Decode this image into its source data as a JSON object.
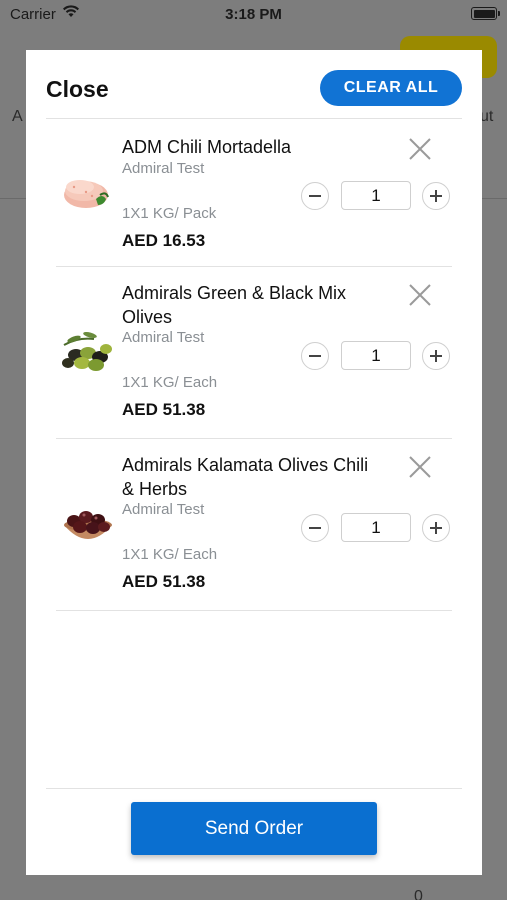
{
  "status_bar": {
    "carrier": "Carrier",
    "time": "3:18 PM"
  },
  "background": {
    "left_fragment": "A",
    "right_fragment": "ut",
    "bottom_qty": "0"
  },
  "modal": {
    "close_label": "Close",
    "clear_all_label": "CLEAR ALL",
    "send_order_label": "Send Order",
    "items": [
      {
        "name": "ADM Chili Mortadella",
        "brand": "Admiral Test",
        "pack": "1X1 KG/ Pack",
        "price": "AED 16.53",
        "qty": "1",
        "image_icon": "mortadella-image"
      },
      {
        "name": "Admirals Green & Black Mix Olives",
        "brand": "Admiral Test",
        "pack": "1X1 KG/ Each",
        "price": "AED 51.38",
        "qty": "1",
        "image_icon": "olives-image"
      },
      {
        "name": "Admirals Kalamata Olives Chili & Herbs",
        "brand": "Admiral Test",
        "pack": "1X1 KG/ Each",
        "price": "AED 51.38",
        "qty": "1",
        "image_icon": "kalamata-olives-image"
      }
    ]
  },
  "colors": {
    "accent": "#1173d4",
    "send": "#0a6fd0",
    "muted_text": "#8a8f94"
  }
}
